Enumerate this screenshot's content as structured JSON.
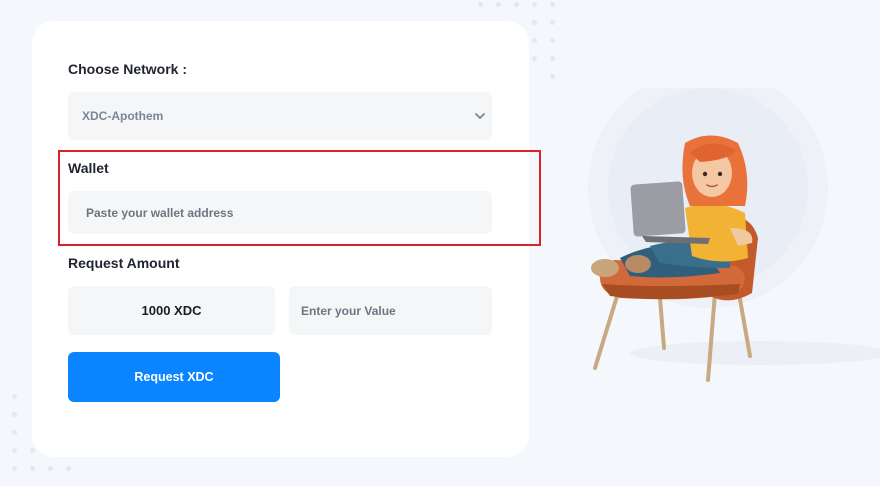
{
  "form": {
    "network_label": "Choose Network :",
    "network_selected": "XDC-Apothem",
    "wallet_label": "Wallet",
    "wallet_placeholder": "Paste your wallet address",
    "amount_label": "Request Amount",
    "amount_fixed": "1000 XDC",
    "amount_placeholder": "Enter your Value",
    "submit_label": "Request XDC"
  },
  "colors": {
    "background": "#f4f7fc",
    "card": "#ffffff",
    "accent": "#0a84ff",
    "highlight": "#d8232a"
  },
  "icons": [
    "chevron-down-icon"
  ]
}
